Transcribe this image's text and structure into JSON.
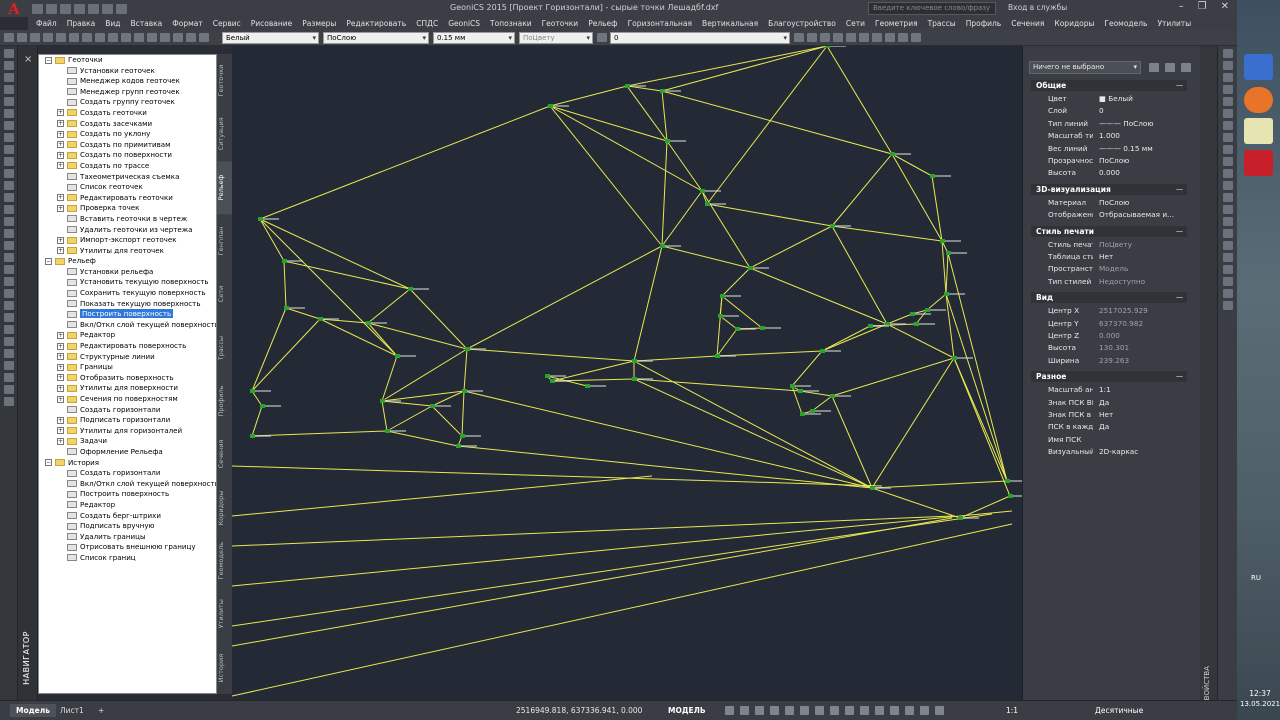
{
  "window": {
    "title": "GeoniCS 2015 [Проект Горизонтали] - сырые точки Лешадбf.dxf",
    "search_placeholder": "Введите ключевое слово/фразу",
    "login": "Вход в службы"
  },
  "menu": [
    "Файл",
    "Правка",
    "Вид",
    "Вставка",
    "Формат",
    "Сервис",
    "Рисование",
    "Размеры",
    "Редактировать",
    "СПДС",
    "GeoniCS",
    "Топознаки",
    "Геоточки",
    "Рельеф",
    "Горизонтальная",
    "Вертикальная",
    "Благоустройство",
    "Сети",
    "Геометрия",
    "Трассы",
    "Профиль",
    "Сечения",
    "Коридоры",
    "Геомодель",
    "Утилиты"
  ],
  "toolbar": {
    "color": "Белый",
    "linetype": "ПоСлою",
    "lineweight": "0.15 мм",
    "plotstyle": "ПоЦвету",
    "layer": "0"
  },
  "navigator": {
    "label": "НАВИГАТОР",
    "close": "×"
  },
  "tree": [
    {
      "t": "Геоточки",
      "lvl": 0,
      "ex": "−",
      "ic": "folder"
    },
    {
      "t": "Установки геоточек",
      "lvl": 1,
      "ic": "cmd"
    },
    {
      "t": "Менеджер кодов геоточек",
      "lvl": 1,
      "ic": "cmd"
    },
    {
      "t": "Менеджер групп геоточек",
      "lvl": 1,
      "ic": "cmd"
    },
    {
      "t": "Создать группу геоточек",
      "lvl": 1,
      "ic": "cmd"
    },
    {
      "t": "Создать геоточки",
      "lvl": 1,
      "ex": "+",
      "ic": "folder"
    },
    {
      "t": "Создать засечками",
      "lvl": 1,
      "ex": "+",
      "ic": "folder"
    },
    {
      "t": "Создать по уклону",
      "lvl": 1,
      "ex": "+",
      "ic": "folder"
    },
    {
      "t": "Создать по примитивам",
      "lvl": 1,
      "ex": "+",
      "ic": "folder"
    },
    {
      "t": "Создать по поверхности",
      "lvl": 1,
      "ex": "+",
      "ic": "folder"
    },
    {
      "t": "Создать по трассе",
      "lvl": 1,
      "ex": "+",
      "ic": "folder"
    },
    {
      "t": "Тахеометрическая съемка",
      "lvl": 1,
      "ic": "cmd"
    },
    {
      "t": "Список геоточек",
      "lvl": 1,
      "ic": "cmd"
    },
    {
      "t": "Редактировать геоточки",
      "lvl": 1,
      "ex": "+",
      "ic": "folder"
    },
    {
      "t": "Проверка точек",
      "lvl": 1,
      "ex": "+",
      "ic": "folder"
    },
    {
      "t": "Вставить геоточки в чертеж",
      "lvl": 1,
      "ic": "cmd"
    },
    {
      "t": "Удалить геоточки из чертежа",
      "lvl": 1,
      "ic": "cmd"
    },
    {
      "t": "Импорт-экспорт геоточек",
      "lvl": 1,
      "ex": "+",
      "ic": "folder"
    },
    {
      "t": "Утилиты для геоточек",
      "lvl": 1,
      "ex": "+",
      "ic": "folder"
    },
    {
      "t": "Рельеф",
      "lvl": 0,
      "ex": "−",
      "ic": "folder"
    },
    {
      "t": "Установки рельефа",
      "lvl": 1,
      "ic": "cmd"
    },
    {
      "t": "Установить текущую поверхность",
      "lvl": 1,
      "ic": "cmd"
    },
    {
      "t": "Сохранить текущую поверхность",
      "lvl": 1,
      "ic": "cmd"
    },
    {
      "t": "Показать текущую поверхность",
      "lvl": 1,
      "ic": "cmd"
    },
    {
      "t": "Построить поверхность",
      "lvl": 1,
      "ic": "cmd",
      "sel": true
    },
    {
      "t": "Вкл/Откл слой текущей поверхности",
      "lvl": 1,
      "ic": "cmd"
    },
    {
      "t": "Редактор",
      "lvl": 1,
      "ex": "+",
      "ic": "folder"
    },
    {
      "t": "Редактировать поверхность",
      "lvl": 1,
      "ex": "+",
      "ic": "folder"
    },
    {
      "t": "Структурные линии",
      "lvl": 1,
      "ex": "+",
      "ic": "folder"
    },
    {
      "t": "Границы",
      "lvl": 1,
      "ex": "+",
      "ic": "folder"
    },
    {
      "t": "Отобразить поверхность",
      "lvl": 1,
      "ex": "+",
      "ic": "folder"
    },
    {
      "t": "Утилиты для поверхности",
      "lvl": 1,
      "ex": "+",
      "ic": "folder"
    },
    {
      "t": "Сечения по поверхностям",
      "lvl": 1,
      "ex": "+",
      "ic": "folder"
    },
    {
      "t": "Создать горизонтали",
      "lvl": 1,
      "ic": "cmd"
    },
    {
      "t": "Подписать горизонтали",
      "lvl": 1,
      "ex": "+",
      "ic": "folder"
    },
    {
      "t": "Утилиты для горизонталей",
      "lvl": 1,
      "ex": "+",
      "ic": "folder"
    },
    {
      "t": "Задачи",
      "lvl": 1,
      "ex": "+",
      "ic": "folder"
    },
    {
      "t": "Оформление Рельефа",
      "lvl": 1,
      "ic": "cmd"
    },
    {
      "t": "История",
      "lvl": 0,
      "ex": "−",
      "ic": "folder"
    },
    {
      "t": "Создать горизонтали",
      "lvl": 1,
      "ic": "cmd"
    },
    {
      "t": "Вкл/Откл слой текущей поверхности",
      "lvl": 1,
      "ic": "cmd"
    },
    {
      "t": "Построить поверхность",
      "lvl": 1,
      "ic": "cmd"
    },
    {
      "t": "Редактор",
      "lvl": 1,
      "ic": "cmd"
    },
    {
      "t": "Создать берг-штрихи",
      "lvl": 1,
      "ic": "cmd"
    },
    {
      "t": "Подписать вручную",
      "lvl": 1,
      "ic": "cmd"
    },
    {
      "t": "Удалить границы",
      "lvl": 1,
      "ic": "cmd"
    },
    {
      "t": "Отрисовать внешнюю границу",
      "lvl": 1,
      "ic": "cmd"
    },
    {
      "t": "Список границ",
      "lvl": 1,
      "ic": "cmd"
    }
  ],
  "vtabs": [
    "Геоточки",
    "Ситуация",
    "Рельеф",
    "Генплан",
    "Сети",
    "Трассы",
    "Профиль",
    "Сечения",
    "Коридоры",
    "Геомодель",
    "Утилиты",
    "История"
  ],
  "vtab_active": "Рельеф",
  "props": {
    "selection": "Ничего не выбрано",
    "sections": [
      {
        "title": "Общие",
        "rows": [
          [
            "Цвет",
            "■ Белый"
          ],
          [
            "Слой",
            "0"
          ],
          [
            "Тип линий",
            "——— ПоСлою"
          ],
          [
            "Масштаб тип...",
            "1.000"
          ],
          [
            "Вес линий",
            "——— 0.15 мм"
          ],
          [
            "Прозрачность",
            "ПоСлою"
          ],
          [
            "Высота",
            "0.000"
          ]
        ]
      },
      {
        "title": "3D-визуализация",
        "rows": [
          [
            "Материал",
            "ПоСлою"
          ],
          [
            "Отображени...",
            "Отбрасываемая и..."
          ]
        ]
      },
      {
        "title": "Стиль печати",
        "rows": [
          [
            "Стиль печати",
            "ПоЦвету",
            1
          ],
          [
            "Таблица стил...",
            "Нет"
          ],
          [
            "Пространств...",
            "Модель",
            1
          ],
          [
            "Тип стилей пе...",
            "Недоступно",
            1
          ]
        ]
      },
      {
        "title": "Вид",
        "rows": [
          [
            "Центр X",
            "2517025.929",
            1
          ],
          [
            "Центр Y",
            "637370.982",
            1
          ],
          [
            "Центр Z",
            "0.000",
            1
          ],
          [
            "Высота",
            "130.301",
            1
          ],
          [
            "Ширина",
            "239.263",
            1
          ]
        ]
      },
      {
        "title": "Разное",
        "rows": [
          [
            "Масштаб анн...",
            "1:1"
          ],
          [
            "Знак ПСК ВКЛ",
            "Да"
          ],
          [
            "Знак ПСК в н...",
            "Нет"
          ],
          [
            "ПСК в кажд...",
            "Да"
          ],
          [
            "Имя ПСК",
            ""
          ],
          [
            "Визуальный с...",
            "2D-каркас"
          ]
        ]
      }
    ],
    "strip_label": "СВОЙСТВА"
  },
  "status": {
    "tab_model": "Модель",
    "tab_sheet": "Лист1",
    "add": "+",
    "coords": "2516949.818, 637336.941, 0.000",
    "model": "МОДЕЛЬ",
    "scale": "1:1",
    "units": "Десятичные"
  },
  "taskbar": {
    "lang": "RU",
    "time": "12:37",
    "date": "13.05.2021"
  },
  "colors": {
    "canvas": "#232a35",
    "tin": "#e8e852",
    "point": "#27a32e",
    "selected": "#3179d8"
  }
}
